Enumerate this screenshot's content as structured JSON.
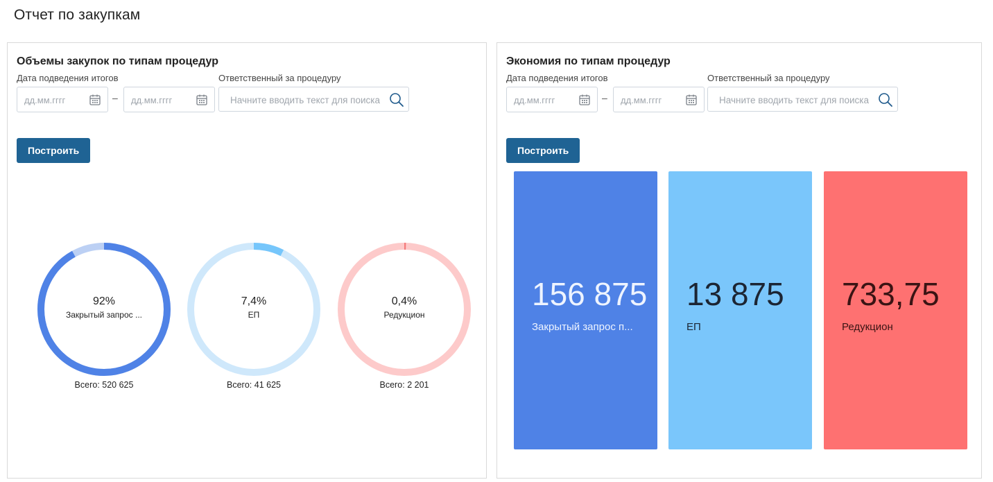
{
  "page": {
    "title": "Отчет по закупкам"
  },
  "left_panel": {
    "title": "Объемы закупок по типам процедур",
    "date_label": "Дата подведения итогов",
    "resp_label": "Ответственный за процедуру",
    "date_from_placeholder": "дд.мм.гггг",
    "date_to_placeholder": "дд.мм.гггг",
    "dash": "–",
    "search_placeholder": "Начните вводить текст для поиска",
    "build_label": "Построить",
    "donuts": [
      {
        "pct": "92%",
        "name": "Закрытый запрос ...",
        "total": "Всего: 520 625",
        "fraction": 0.92,
        "color": "#4f82e6",
        "track": "#bcd0f4"
      },
      {
        "pct": "7,4%",
        "name": "ЕП",
        "total": "Всего: 41 625",
        "fraction": 0.074,
        "color": "#76c6fb",
        "track": "#cfe8fb"
      },
      {
        "pct": "0,4%",
        "name": "Редукцион",
        "total": "Всего: 2 201",
        "fraction": 0.004,
        "color": "#f47b7b",
        "track": "#fdcaca"
      }
    ]
  },
  "right_panel": {
    "title": "Экономия по типам процедур",
    "date_label": "Дата подведения итогов",
    "resp_label": "Ответственный за процедуру",
    "date_from_placeholder": "дд.мм.гггг",
    "date_to_placeholder": "дд.мм.гггг",
    "dash": "–",
    "search_placeholder": "Начните вводить текст для поиска",
    "build_label": "Построить",
    "tiles": [
      {
        "value": "156 875",
        "name": "Закрытый запрос п...",
        "color": "#4f82e6",
        "text_color": "#eef4ff"
      },
      {
        "value": "13 875",
        "name": "ЕП",
        "color": "#7ac6fb",
        "text_color": "#1c2533"
      },
      {
        "value": "733,75",
        "name": "Редукцион",
        "color": "#fe7171",
        "text_color": "#3a1414"
      }
    ]
  },
  "icons": {
    "calendar": "calendar-icon",
    "search": "search-icon"
  }
}
